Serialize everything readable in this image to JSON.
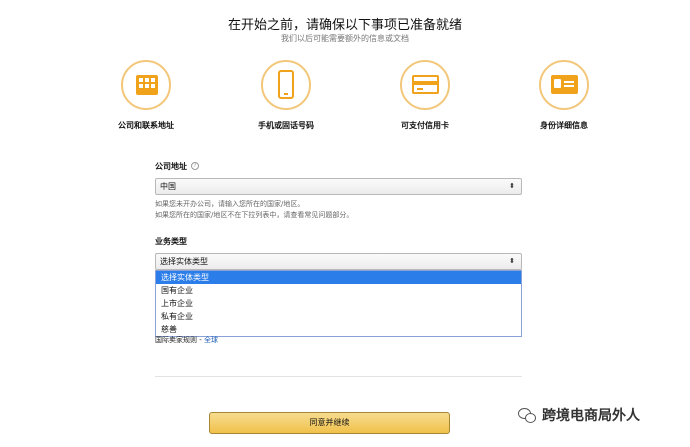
{
  "header": {
    "title": "在开始之前，请确保以下事项已准备就绪",
    "subtitle": "我们以后可能需要额外的信息或文档"
  },
  "steps": [
    {
      "label": "公司和联系地址",
      "icon": "building-icon"
    },
    {
      "label": "手机或固话号码",
      "icon": "phone-icon"
    },
    {
      "label": "可支付信用卡",
      "icon": "credit-card-icon"
    },
    {
      "label": "身份详细信息",
      "icon": "id-card-icon"
    }
  ],
  "form": {
    "company_address": {
      "label": "公司地址",
      "value": "中国",
      "hint_1": "如果您未开办公司，请输入您所在的国家/地区。",
      "hint_2": "如果您所在的国家/地区不在下拉列表中，请查看常见问题部分。"
    },
    "business_type": {
      "label": "业务类型",
      "value": "选择实体类型",
      "options": [
        "选择实体类型",
        "国有企业",
        "上市企业",
        "私有企业",
        "慈善"
      ],
      "selected_index": 0
    }
  },
  "policy": {
    "text": "国际卖家规则 - ",
    "link": "全球"
  },
  "buttons": {
    "continue": "同意并继续"
  },
  "watermark": {
    "text": "跨境电商局外人"
  },
  "colors": {
    "accent": "#f0a21b",
    "button": "#f0c14b",
    "selected_option": "#2b7de9"
  }
}
